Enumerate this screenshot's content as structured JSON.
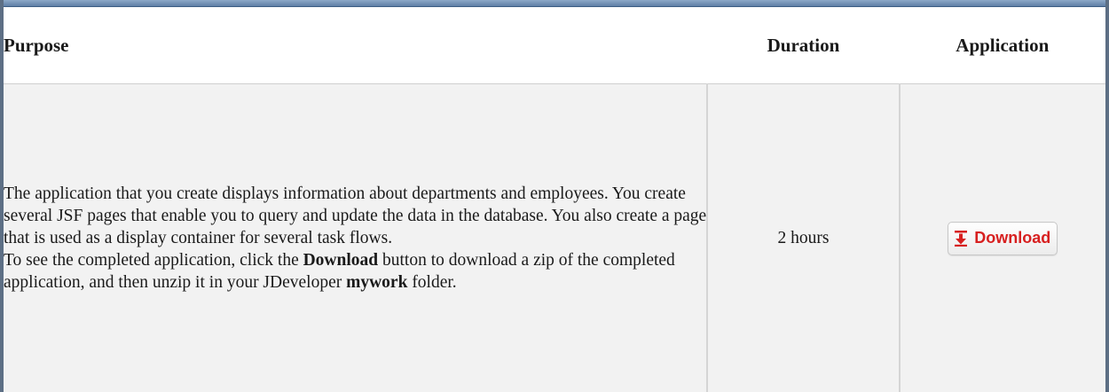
{
  "colors": {
    "accent_red": "#d72020",
    "cell_background": "#f2f2f2",
    "header_background": "#ffffff"
  },
  "table": {
    "headers": {
      "purpose": "Purpose",
      "duration": "Duration",
      "application": "Application"
    },
    "row": {
      "purpose": {
        "line_1": "The application that you create displays information about departments and employees. You create several JSF pages that enable you to query and update the data in the database. You also create a page that is used as a display container for several task flows.",
        "line_2_prefix": "To see the completed application, click the ",
        "line_2_bold": "Download",
        "line_2_mid": " button to download a zip of the completed application, and then unzip it in your JDeveloper ",
        "line_2_bold2": "mywork",
        "line_2_suffix": " folder."
      },
      "duration": "2 hours",
      "application": {
        "button_label": "Download",
        "button_icon": "download-arrow-icon"
      }
    }
  }
}
